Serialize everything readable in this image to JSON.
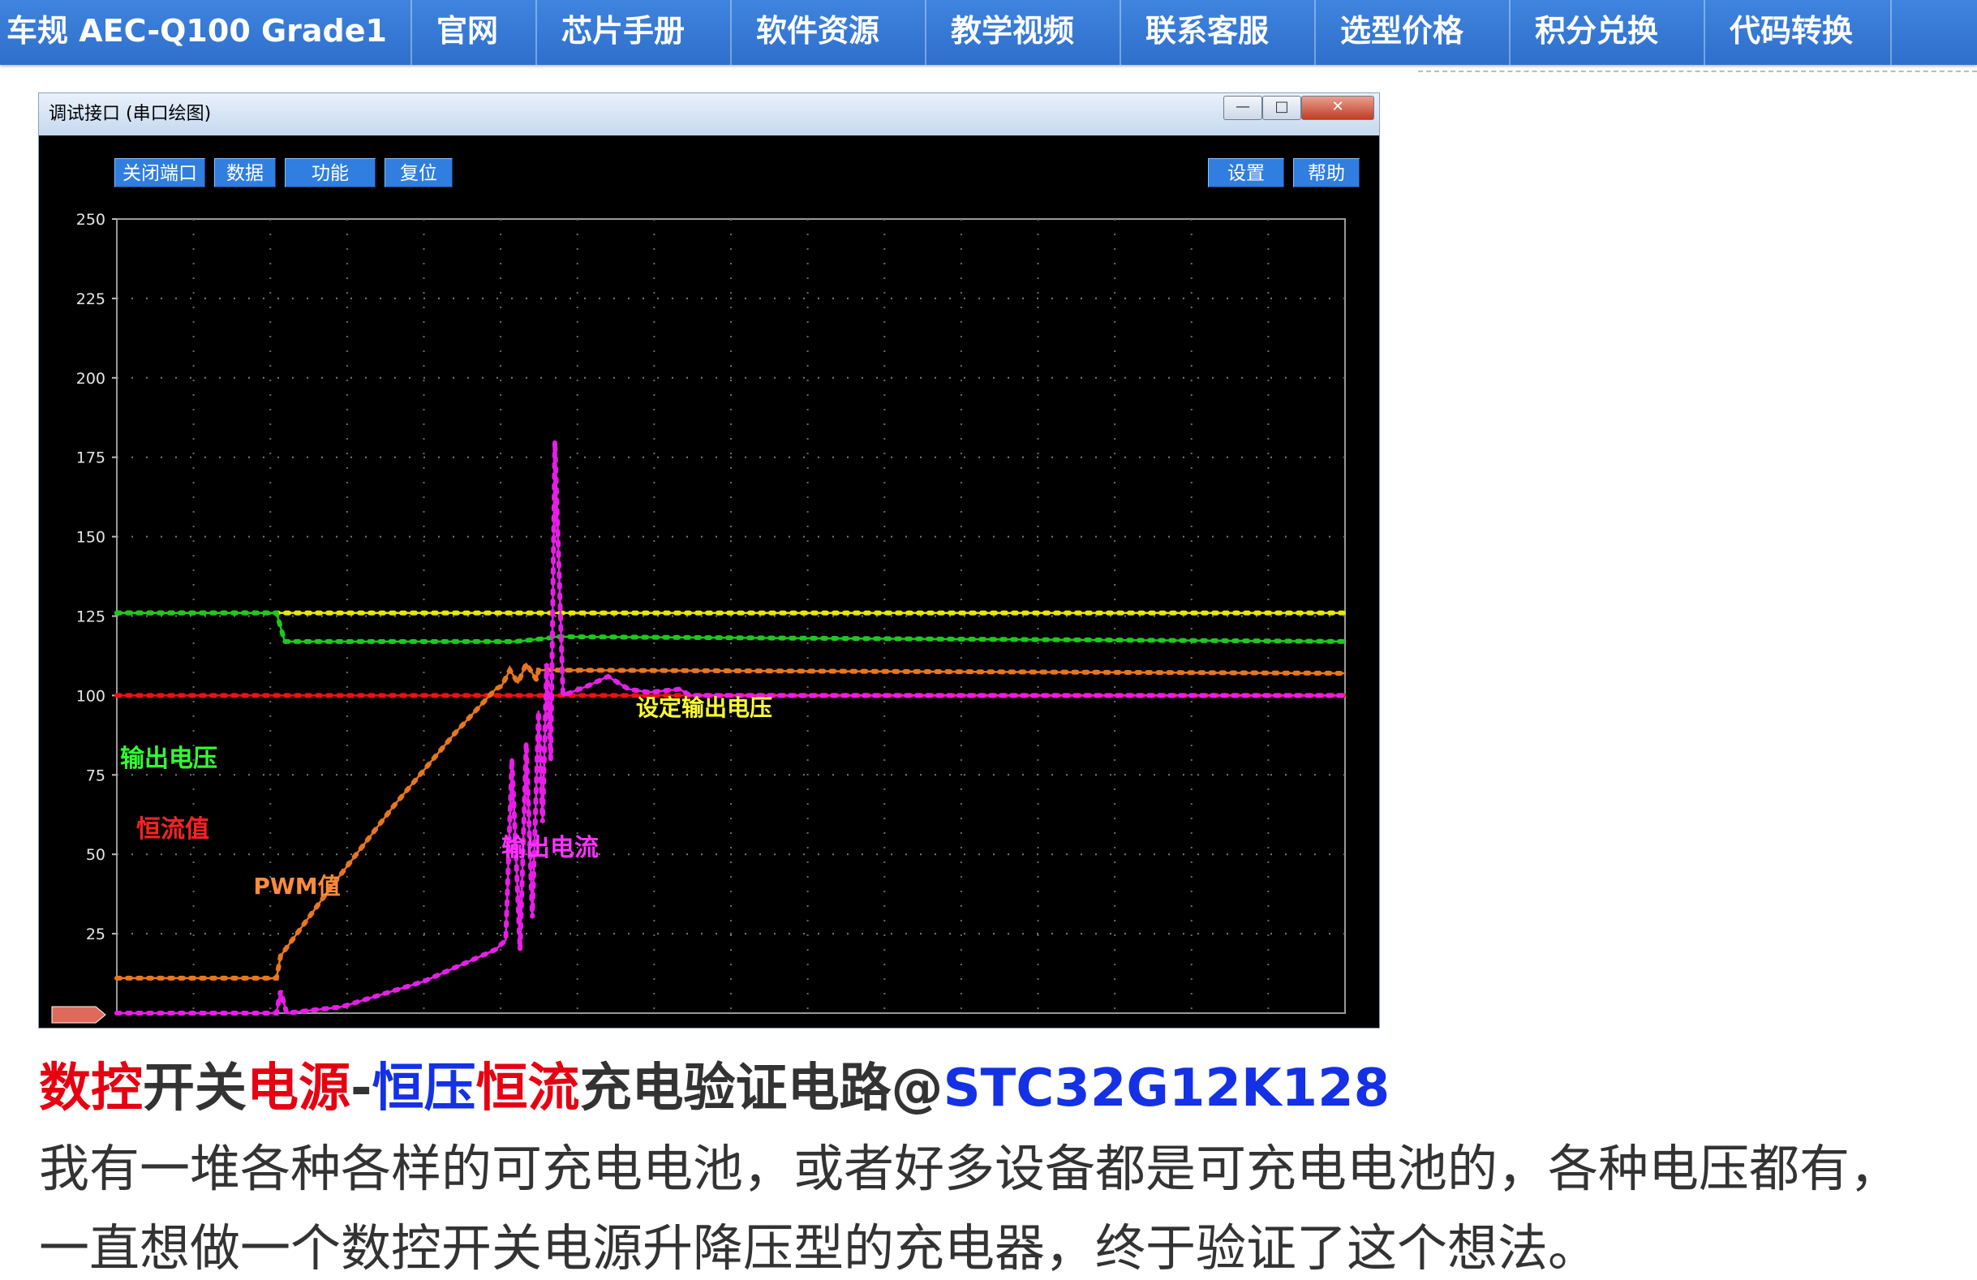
{
  "nav": {
    "brand": "车规 AEC-Q100 Grade1",
    "items": [
      "官网",
      "芯片手册",
      "软件资源",
      "教学视频",
      "联系客服",
      "选型价格",
      "积分兑换",
      "代码转换"
    ]
  },
  "window": {
    "title": "调试接口 (串口绘图)",
    "blurred_tabs": "",
    "controls": {
      "minimize": "—",
      "maximize": "□",
      "close": "✕"
    },
    "toolbar_left": [
      "关闭端口",
      "数据",
      "功能",
      "复位"
    ],
    "toolbar_right": [
      "设置",
      "帮助"
    ]
  },
  "chart_data": {
    "type": "line",
    "ylim": [
      0,
      250
    ],
    "yticks": [
      250,
      225,
      200,
      175,
      150,
      125,
      100,
      75,
      50,
      25
    ],
    "grid": true,
    "x_range": [
      0,
      600
    ],
    "series": [
      {
        "name": "设定输出电压",
        "color": "#e8e800",
        "points": [
          [
            0,
            126
          ],
          [
            600,
            126
          ]
        ]
      },
      {
        "name": "输出电压",
        "color": "#1ec81e",
        "points": [
          [
            0,
            126
          ],
          [
            78,
            126
          ],
          [
            82,
            117
          ],
          [
            195,
            117
          ],
          [
            210,
            118
          ],
          [
            215,
            118.5
          ],
          [
            600,
            117
          ]
        ]
      },
      {
        "name": "恒流值",
        "color": "#ee1111",
        "points": [
          [
            0,
            100
          ],
          [
            600,
            100
          ]
        ]
      },
      {
        "name": "PWM值",
        "color": "#e8761e",
        "points": [
          [
            0,
            11
          ],
          [
            78,
            11
          ],
          [
            80,
            18
          ],
          [
            105,
            40
          ],
          [
            135,
            65
          ],
          [
            165,
            88
          ],
          [
            185,
            102
          ],
          [
            188,
            103
          ],
          [
            192,
            108
          ],
          [
            196,
            104
          ],
          [
            200,
            110
          ],
          [
            205,
            105
          ],
          [
            206,
            108
          ],
          [
            600,
            107
          ]
        ]
      },
      {
        "name": "输出电流",
        "color": "#e81ee8",
        "points": [
          [
            0,
            0
          ],
          [
            78,
            0
          ],
          [
            80,
            7
          ],
          [
            83,
            0
          ],
          [
            110,
            2
          ],
          [
            150,
            10
          ],
          [
            185,
            20
          ],
          [
            190,
            23
          ],
          [
            193,
            80
          ],
          [
            197,
            20
          ],
          [
            200,
            85
          ],
          [
            203,
            30
          ],
          [
            206,
            95
          ],
          [
            208,
            60
          ],
          [
            210,
            110
          ],
          [
            212,
            80
          ],
          [
            214,
            180
          ],
          [
            218,
            100
          ],
          [
            230,
            103
          ],
          [
            240,
            106
          ],
          [
            250,
            102
          ],
          [
            260,
            101
          ],
          [
            275,
            102
          ],
          [
            280,
            100
          ],
          [
            600,
            100
          ]
        ]
      }
    ],
    "annotations": [
      {
        "text": "设定输出电压",
        "color": "#ffff33"
      },
      {
        "text": "输出电压",
        "color": "#33ff33"
      },
      {
        "text": "恒流值",
        "color": "#ff2222"
      },
      {
        "text": "PWM值",
        "color": "#ff8c3a"
      },
      {
        "text": "输出电流",
        "color": "#ff33ff"
      }
    ]
  },
  "article": {
    "title_parts": [
      {
        "text": "数控",
        "color": "red"
      },
      {
        "text": "开关",
        "color": "dark"
      },
      {
        "text": "电源",
        "color": "red"
      },
      {
        "text": "-",
        "color": "dark"
      },
      {
        "text": "恒压",
        "color": "blue"
      },
      {
        "text": "恒流",
        "color": "red"
      },
      {
        "text": "充电验证电路@",
        "color": "dark"
      },
      {
        "text": "STC32G12K128",
        "color": "blue"
      }
    ],
    "body_lines": [
      "我有一堆各种各样的可充电电池，或者好多设备都是可充电电池的，各种电压都有，",
      "一直想做一个数控开关电源升降压型的充电器，终于验证了这个想法。"
    ]
  }
}
